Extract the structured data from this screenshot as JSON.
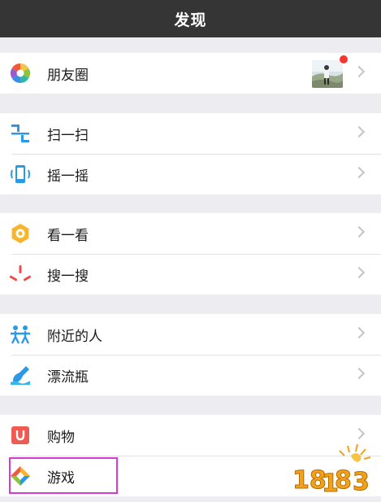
{
  "header": {
    "title": "发现"
  },
  "groups": [
    {
      "items": [
        {
          "label": "朋友圈",
          "icon": "moments-aperture-icon",
          "has_thumbnail": true,
          "has_badge_dot": true
        }
      ]
    },
    {
      "items": [
        {
          "label": "扫一扫",
          "icon": "scan-icon"
        },
        {
          "label": "摇一摇",
          "icon": "shake-phone-icon"
        }
      ]
    },
    {
      "items": [
        {
          "label": "看一看",
          "icon": "top-stories-icon"
        },
        {
          "label": "搜一搜",
          "icon": "search-sparkle-icon"
        }
      ]
    },
    {
      "items": [
        {
          "label": "附近的人",
          "icon": "people-nearby-icon"
        },
        {
          "label": "漂流瓶",
          "icon": "drift-bottle-icon"
        }
      ]
    },
    {
      "items": [
        {
          "label": "购物",
          "icon": "shopping-bag-icon"
        },
        {
          "label": "游戏",
          "icon": "games-icon"
        }
      ]
    }
  ],
  "watermark": {
    "text": "18183"
  },
  "colors": {
    "header_bg": "#353535",
    "page_bg": "#ececf1",
    "badge_dot": "#f43530",
    "highlight_border": "#d63ad0"
  }
}
